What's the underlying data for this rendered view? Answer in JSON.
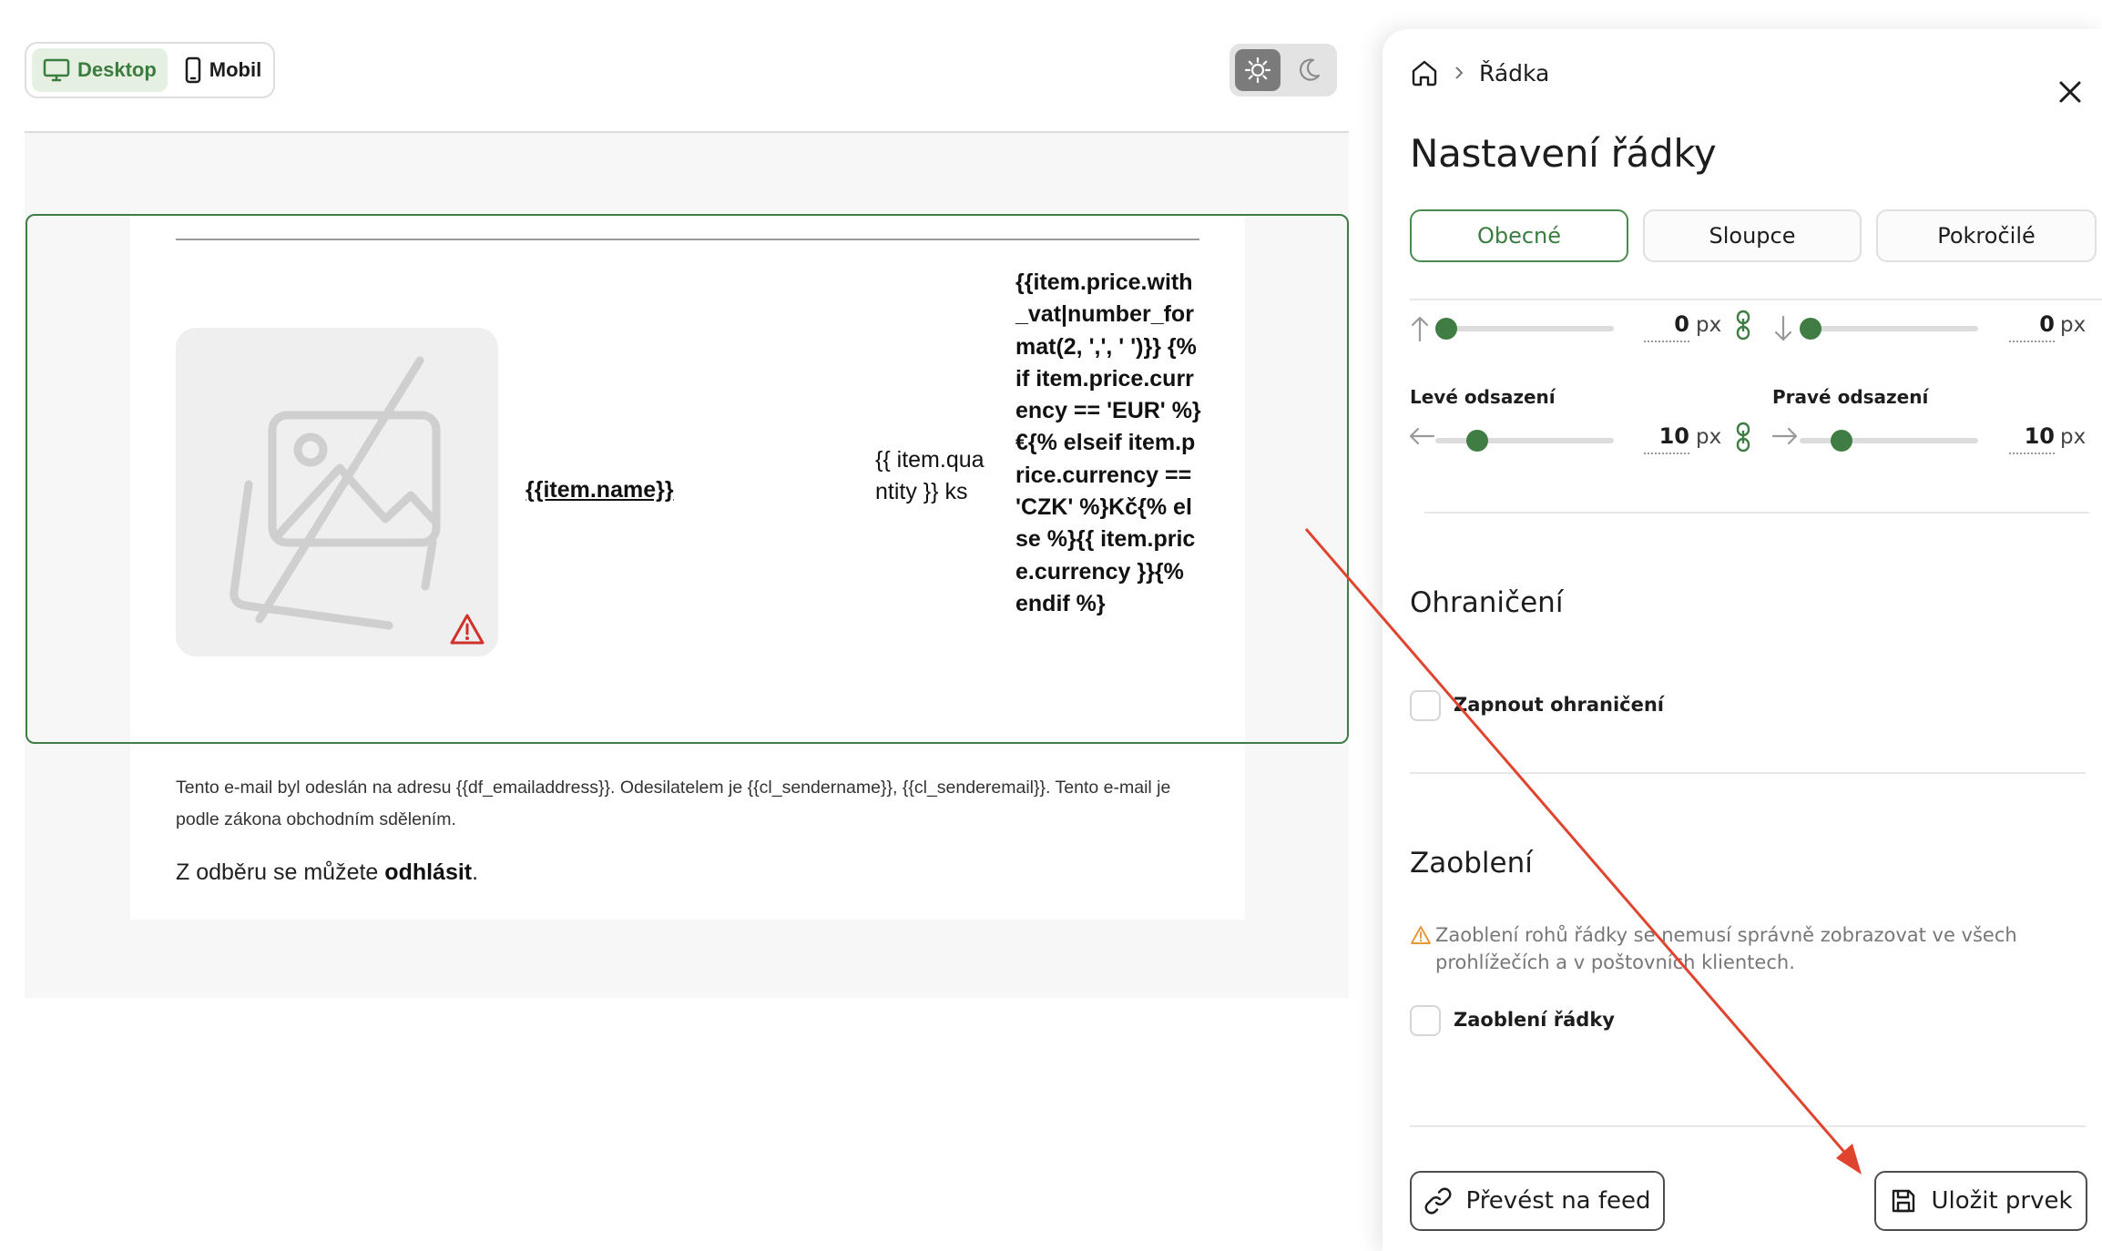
{
  "preview": {
    "device_toggle": {
      "desktop_label": "Desktop",
      "mobile_label": "Mobil",
      "selected": "Desktop"
    },
    "theme": {
      "selected": "light"
    },
    "product_row": {
      "name": "{{item.name}}",
      "quantity": "{{ item.quantity }} ks",
      "price": "{{item.price.with_vat|number_format(2, ',', ' ')}} {% if item.price.currency == 'EUR' %}€{% elseif item.price.currency == 'CZK' %}Kč{% else %}{{ item.price.currency }}{% endif %}"
    },
    "footer": {
      "text": "Tento e-mail byl odeslán na adresu {{df_emailaddress}}. Odesilatelem je {{cl_sendername}}, {{cl_senderemail}}. Tento e-mail je podle zákona obchodním sdělením.",
      "unsubscribe_prefix": "Z odběru se můžete ",
      "unsubscribe_link": "odhlásit",
      "unsubscribe_suffix": "."
    }
  },
  "panel": {
    "breadcrumb": "Řádka",
    "title": "Nastavení řádky",
    "tabs": [
      {
        "label": "Obecné",
        "active": true
      },
      {
        "label": "Sloupce",
        "active": false
      },
      {
        "label": "Pokročilé",
        "active": false
      }
    ],
    "padding": {
      "top": {
        "value": "0",
        "unit": "px",
        "level": 0
      },
      "bottom": {
        "value": "0",
        "unit": "px",
        "level": 0
      },
      "left": {
        "label": "Levé odsazení",
        "value": "10",
        "unit": "px",
        "level": 0.2
      },
      "right": {
        "label": "Pravé odsazení",
        "value": "10",
        "unit": "px",
        "level": 0.2
      }
    },
    "border": {
      "title": "Ohraničení",
      "checkbox_label": "Zapnout ohraničení",
      "checked": false
    },
    "rounding": {
      "title": "Zaoblení",
      "warning": "Zaoblení rohů řádky se nemusí správně zobrazovat ve všech prohlížečích a v poštovních klientech.",
      "checkbox_label": "Zaoblení řádky",
      "checked": false
    },
    "buttons": {
      "convert_label": "Převést na feed",
      "save_label": "Uložit prvek"
    }
  },
  "colors": {
    "accent": "#3f7d45",
    "annotation_arrow": "#e0442e",
    "warning": "#e39a3b",
    "error": "#d0322b"
  }
}
